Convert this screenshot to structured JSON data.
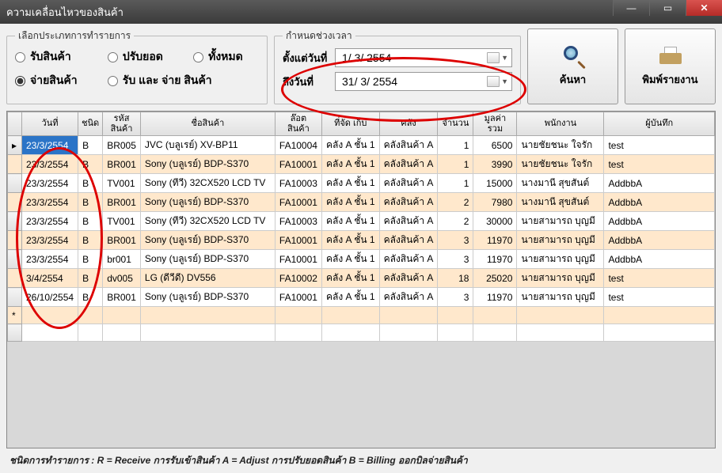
{
  "window": {
    "title": "ความเคลื่อนไหวของสินค้า"
  },
  "filter": {
    "legend": "เลือกประเภทการทำรายการ",
    "opt_receive": "รับสินค้า",
    "opt_adjust": "ปรับยอด",
    "opt_all": "ทั้งหมด",
    "opt_bill": "จ่ายสินค้า",
    "opt_rb": "รับ และ จ่าย สินค้า"
  },
  "dates": {
    "legend": "กำหนดช่วงเวลา",
    "from_label": "ตั้งแต่วันที่",
    "to_label": "ถึงวันที่",
    "from": "1/ 3/ 2554",
    "to": "31/ 3/ 2554"
  },
  "buttons": {
    "search": "ค้นหา",
    "print": "พิมพ์รายงาน"
  },
  "grid": {
    "headers": {
      "date": "วันที่",
      "type": "ชนิด",
      "code": "รหัส\nสินค้า",
      "name": "ชื่อสินค้า",
      "lot": "ล๊อต\nสินค้า",
      "shelf": "ที่จัด\nเก็บ",
      "warehouse": "คลัง",
      "qty": "จำนวน",
      "total": "มูลค่า\nรวม",
      "staff": "พนักงาน",
      "user": "ผู้บันทึก"
    },
    "rows": [
      {
        "date": "23/3/2554",
        "type": "B",
        "code": "BR005",
        "name": "JVC (บลูเรย์) XV-BP11",
        "lot": "FA10004",
        "shelf": "คลัง A ชั้น 1",
        "wh": "คลังสินค้า A",
        "qty": "1",
        "total": "6500",
        "staff": "นายชัยชนะ ใจรัก",
        "user": "test",
        "sel": true
      },
      {
        "date": "23/3/2554",
        "type": "B",
        "code": "BR001",
        "name": "Sony (บลูเรย์) BDP-S370",
        "lot": "FA10001",
        "shelf": "คลัง A ชั้น 1",
        "wh": "คลังสินค้า A",
        "qty": "1",
        "total": "3990",
        "staff": "นายชัยชนะ ใจรัก",
        "user": "test",
        "alt": true
      },
      {
        "date": "23/3/2554",
        "type": "B",
        "code": "TV001",
        "name": "Sony (ทีวี) 32CX520 LCD TV",
        "lot": "FA10003",
        "shelf": "คลัง A ชั้น 1",
        "wh": "คลังสินค้า A",
        "qty": "1",
        "total": "15000",
        "staff": "นางมานี สุขสันต์",
        "user": "AddbbA"
      },
      {
        "date": "23/3/2554",
        "type": "B",
        "code": "BR001",
        "name": "Sony (บลูเรย์) BDP-S370",
        "lot": "FA10001",
        "shelf": "คลัง A ชั้น 1",
        "wh": "คลังสินค้า A",
        "qty": "2",
        "total": "7980",
        "staff": "นางมานี สุขสันต์",
        "user": "AddbbA",
        "alt": true
      },
      {
        "date": "23/3/2554",
        "type": "B",
        "code": "TV001",
        "name": "Sony (ทีวี) 32CX520 LCD TV",
        "lot": "FA10003",
        "shelf": "คลัง A ชั้น 1",
        "wh": "คลังสินค้า A",
        "qty": "2",
        "total": "30000",
        "staff": "นายสามารถ บุญมี",
        "user": "AddbbA"
      },
      {
        "date": "23/3/2554",
        "type": "B",
        "code": "BR001",
        "name": "Sony (บลูเรย์) BDP-S370",
        "lot": "FA10001",
        "shelf": "คลัง A ชั้น 1",
        "wh": "คลังสินค้า A",
        "qty": "3",
        "total": "11970",
        "staff": "นายสามารถ บุญมี",
        "user": "AddbbA",
        "alt": true
      },
      {
        "date": "23/3/2554",
        "type": "B",
        "code": "br001",
        "name": "Sony (บลูเรย์) BDP-S370",
        "lot": "FA10001",
        "shelf": "คลัง A ชั้น 1",
        "wh": "คลังสินค้า A",
        "qty": "3",
        "total": "11970",
        "staff": "นายสามารถ บุญมี",
        "user": "AddbbA"
      },
      {
        "date": "3/4/2554",
        "type": "B",
        "code": "dv005",
        "name": "LG (ดีวีดี) DV556",
        "lot": "FA10002",
        "shelf": "คลัง A ชั้น 1",
        "wh": "คลังสินค้า A",
        "qty": "18",
        "total": "25020",
        "staff": "นายสามารถ บุญมี",
        "user": "test",
        "alt": true
      },
      {
        "date": "26/10/2554",
        "type": "B",
        "code": "BR001",
        "name": "Sony (บลูเรย์) BDP-S370",
        "lot": "FA10001",
        "shelf": "คลัง A ชั้น 1",
        "wh": "คลังสินค้า A",
        "qty": "3",
        "total": "11970",
        "staff": "นายสามารถ บุญมี",
        "user": "test"
      }
    ]
  },
  "footer": "ชนิดการทำรายการ : R = Receive การรับเข้าสินค้า   A = Adjust การปรับยอดสินค้า   B = Billing ออกบิลจ่ายสินค้า"
}
